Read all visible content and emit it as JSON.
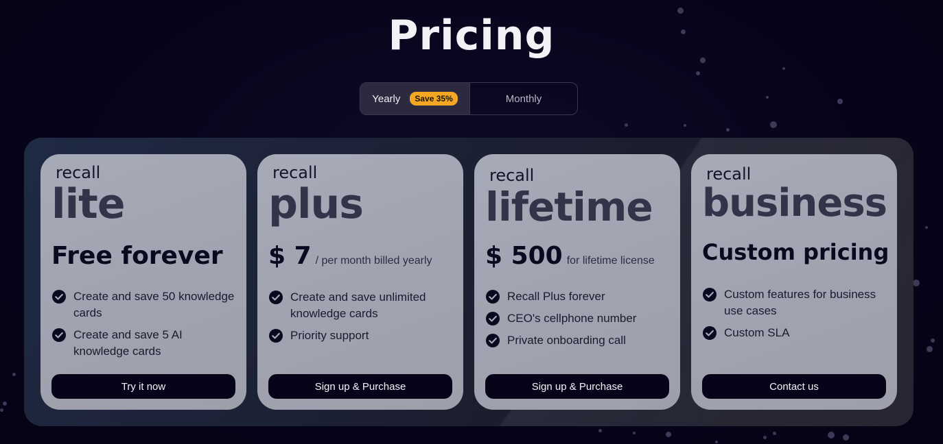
{
  "header": {
    "title": "Pricing"
  },
  "billing_toggle": {
    "yearly_label": "Yearly",
    "save_badge": "Save 35%",
    "monthly_label": "Monthly",
    "selected": "Yearly"
  },
  "plans": [
    {
      "brand": "recall",
      "name": "lite",
      "price_main": "Free forever",
      "price_note": "",
      "features": [
        "Create and save 50 knowledge cards",
        "Create and save 5 AI knowledge cards"
      ],
      "cta": "Try it now"
    },
    {
      "brand": "recall",
      "name": "plus",
      "price_main": "$ 7",
      "price_note": "/ per month billed yearly",
      "features": [
        "Create and save unlimited knowledge cards",
        "Priority support"
      ],
      "cta": "Sign up & Purchase"
    },
    {
      "brand": "recall",
      "name": "lifetime",
      "price_main": "$ 500",
      "price_note": "for lifetime license",
      "features": [
        "Recall Plus forever",
        "CEO's cellphone number",
        "Private onboarding call"
      ],
      "cta": "Sign up & Purchase"
    },
    {
      "brand": "recall",
      "name": "business",
      "price_main": "Custom pricing",
      "price_note": "",
      "features": [
        "Custom features for business use cases",
        "Custom SLA"
      ],
      "cta": "Contact us"
    }
  ],
  "colors": {
    "background": "#07041a",
    "card": "#a1a4b0",
    "badge": "#f5a623",
    "button": "#07041a"
  },
  "icons": {
    "feature": "check-circle-icon"
  }
}
